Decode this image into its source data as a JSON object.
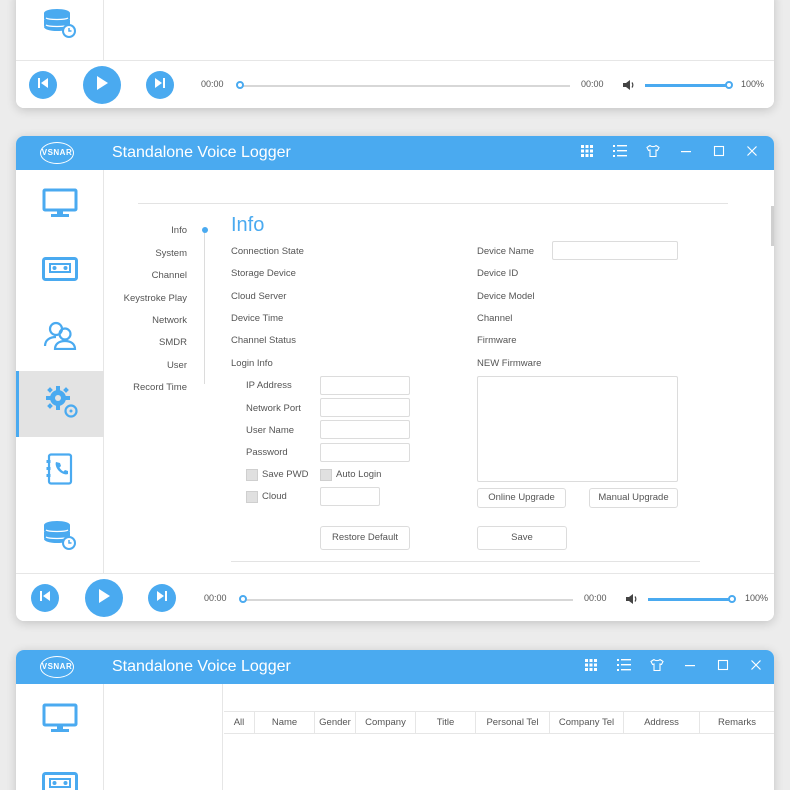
{
  "app": {
    "title": "Standalone Voice Logger",
    "logo_text": "VSNAR"
  },
  "player_top": {
    "time_start": "00:00",
    "time_end": "00:00",
    "volume": "100%",
    "volume_level": 1.0
  },
  "player_mid": {
    "time_start": "00:00",
    "time_end": "00:00",
    "volume": "100%",
    "volume_level": 1.0
  },
  "settings_nav": [
    "Info",
    "System",
    "Channel",
    "Keystroke Play",
    "Network",
    "SMDR",
    "User",
    "Record Time"
  ],
  "info": {
    "heading": "Info",
    "left_labels": [
      "Connection State",
      "Storage Device",
      "Cloud Server",
      "Device Time",
      "Channel Status",
      "Login Info"
    ],
    "login": {
      "ip_label": "IP Address",
      "port_label": "Network Port",
      "user_label": "User Name",
      "password_label": "Password",
      "save_pwd": "Save PWD",
      "auto_login": "Auto Login",
      "cloud": "Cloud"
    },
    "right_labels": [
      "Device Name",
      "Device ID",
      "Device Model",
      "Channel",
      "Firmware",
      "NEW Firmware"
    ],
    "buttons": {
      "online_upgrade": "Online Upgrade",
      "manual_upgrade": "Manual Upgrade",
      "restore_default": "Restore Default",
      "save": "Save"
    }
  },
  "contacts_table": {
    "headers": [
      "All",
      "Name",
      "Gender",
      "Company",
      "Title",
      "Personal Tel",
      "Company Tel",
      "Address",
      "Remarks"
    ]
  },
  "colors": {
    "accent": "#4aaaf0"
  }
}
